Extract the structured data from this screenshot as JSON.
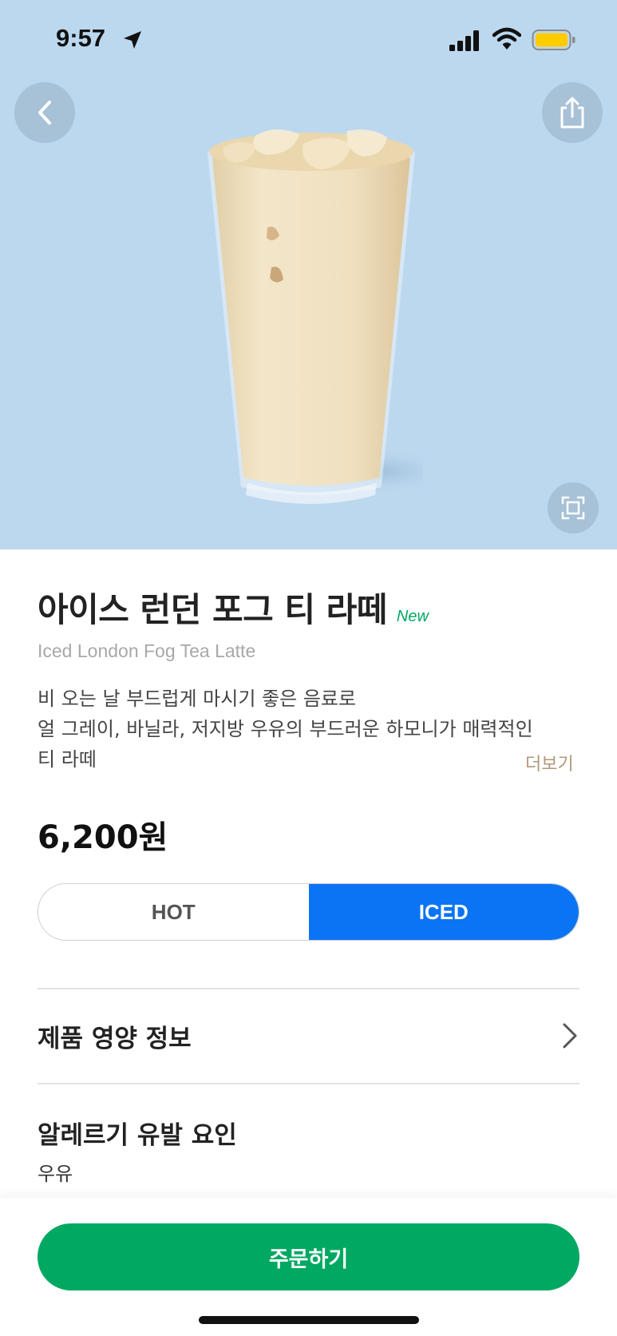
{
  "status_bar": {
    "time": "9:57",
    "icons": [
      "location-arrow-icon",
      "cellular-signal-icon",
      "wifi-icon",
      "battery-icon"
    ],
    "battery_color": "#ffcc00"
  },
  "hero": {
    "background_color": "#bcd8ef",
    "icons": [
      "back-chevron-icon",
      "share-icon",
      "expand-icon"
    ]
  },
  "product": {
    "name_ko": "아이스 런던 포그 티 라떼",
    "badge": "New",
    "name_en": "Iced London Fog Tea Latte",
    "description_lines": [
      "비 오는 날 부드럽게 마시기 좋은 음료로",
      "얼 그레이, 바닐라, 저지방 우유의 부드러운 하모니가 매력적인",
      "티 라떼"
    ],
    "more_label": "더보기",
    "price": "6,200원"
  },
  "temperature_toggle": {
    "options": [
      "HOT",
      "ICED"
    ],
    "selected": "ICED",
    "accent_color": "#0a74f5"
  },
  "nutrition": {
    "label": "제품 영양 정보"
  },
  "allergy": {
    "label": "알레르기 유발 요인",
    "value": "우유"
  },
  "order_button": {
    "label": "주문하기",
    "color": "#00a862"
  }
}
